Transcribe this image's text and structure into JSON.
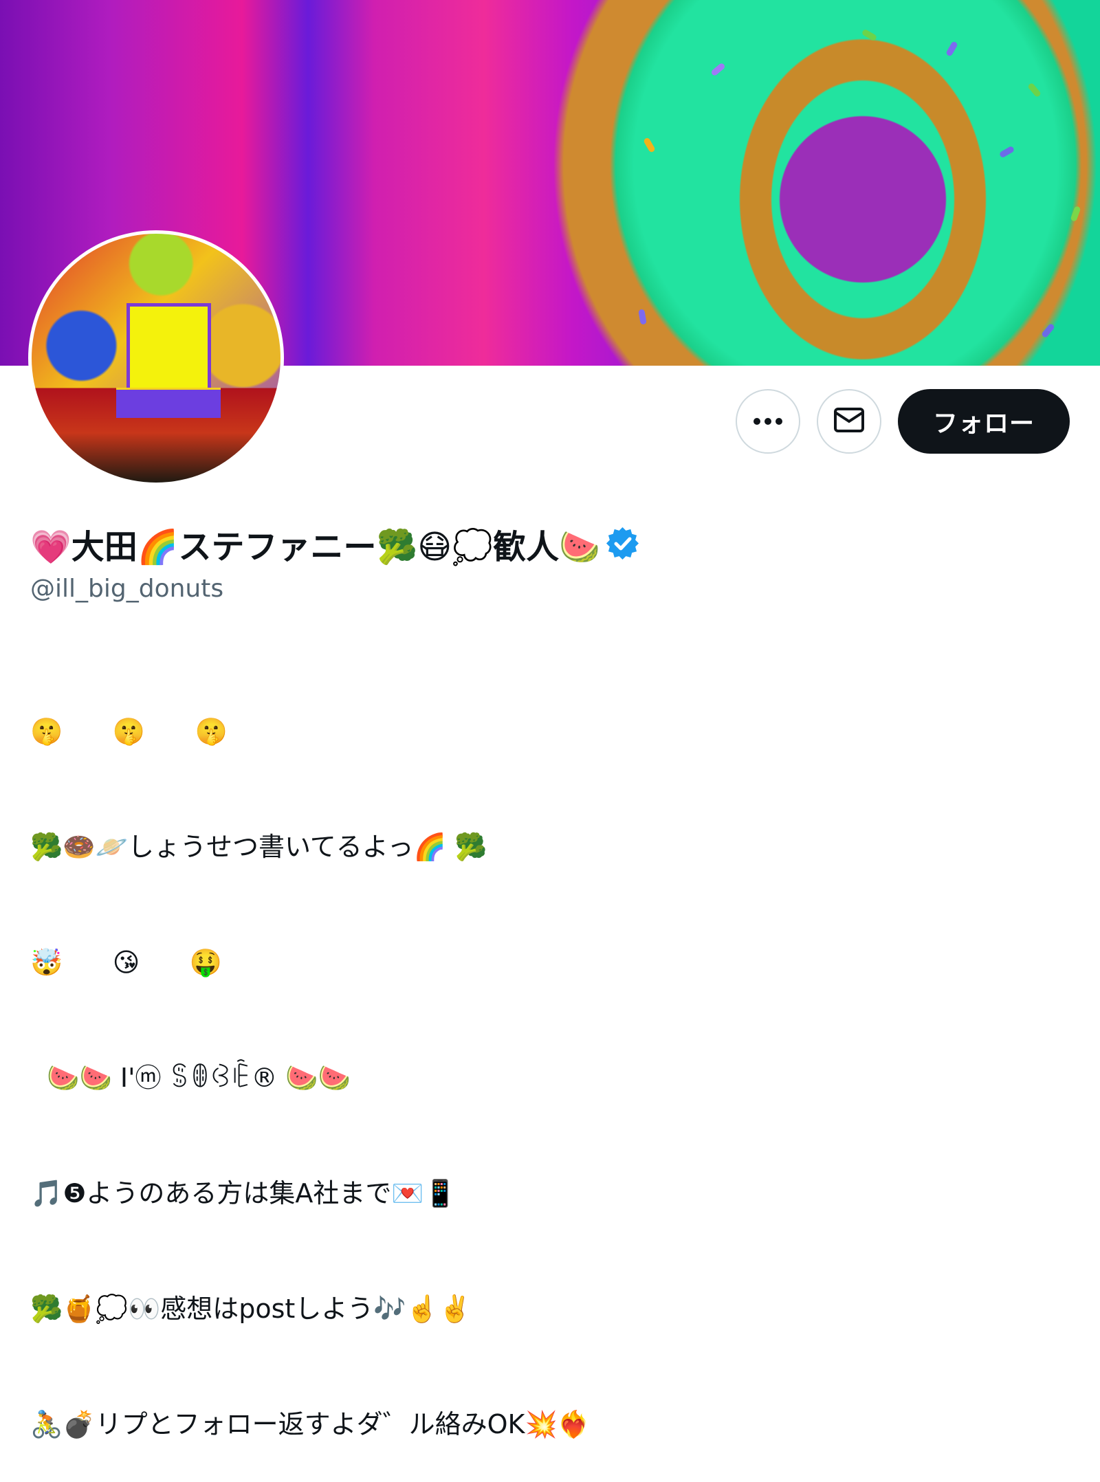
{
  "profile": {
    "display_name": "💗大田🌈ステファニー🥦😷💭歓人🍉",
    "verified": true,
    "verified_color": "#1d9bf0",
    "handle": "@ill_big_donuts",
    "bio_lines": [
      "🤫      🤫      🤫",
      "🥦🍩🪐しょうせつ書いてるよっ🌈 🥦",
      "🤯      😘      🤑",
      "  🍉🍉 I'ⓜ ꌚꂦꃳꍟ® 🍉🍉",
      "🎵❺ようのある方は集A社まで💌📱",
      "🥦🍯💭👀感想はpostしよう🎶☝️✌️",
      "🚴💣リプとフォロー返すよダ゛ル絡みOK💥❤️‍🔥"
    ]
  },
  "actions": {
    "more_icon": "more-horizontal-icon",
    "message_icon": "envelope-icon",
    "follow_label": "フォロー"
  },
  "colors": {
    "follow_bg": "#0f1419",
    "handle_text": "#536471",
    "border": "#cfd9de"
  }
}
